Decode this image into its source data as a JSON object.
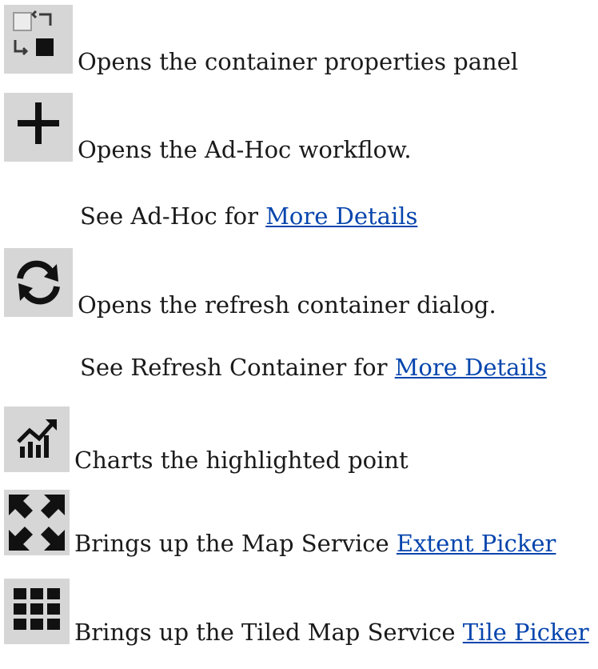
{
  "items": [
    {
      "icon": "container-properties-icon",
      "text": "Opens the container properties panel"
    },
    {
      "icon": "plus-icon",
      "text": "Opens the Ad-Hoc workflow.",
      "see_text": "See Ad-Hoc for ",
      "see_link": "More Details"
    },
    {
      "icon": "refresh-icon",
      "text": "Opens the refresh container dialog.",
      "see_text": "See Refresh Container for ",
      "see_link": "More Details"
    },
    {
      "icon": "chart-trend-icon",
      "text": "Charts the highlighted point"
    },
    {
      "icon": "expand-arrows-icon",
      "text": "Brings up the Map Service ",
      "link": "Extent Picker"
    },
    {
      "icon": "grid-tiles-icon",
      "text": "Brings up the Tiled Map Service ",
      "link": "Tile Picker"
    }
  ],
  "colors": {
    "icon_background": "#d6d6d6",
    "link": "#0645ad",
    "text": "#1a1a1a"
  }
}
